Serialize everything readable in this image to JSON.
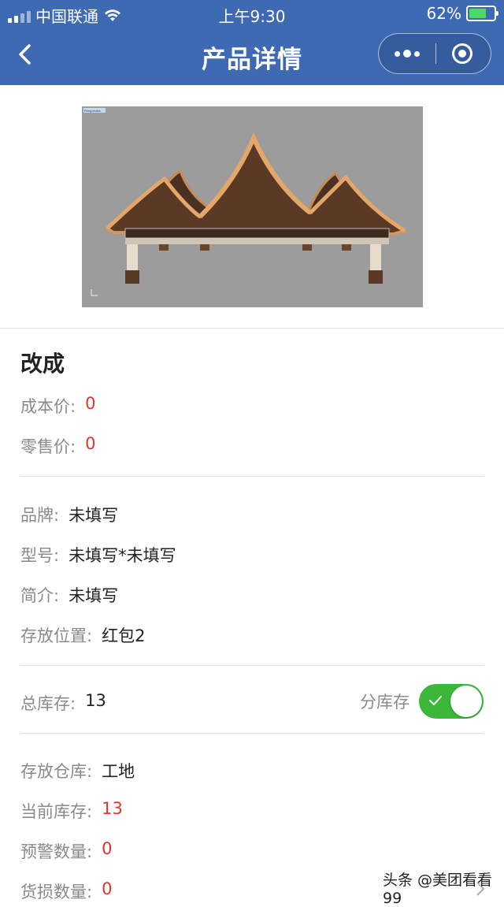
{
  "status_bar": {
    "carrier": "中国联通",
    "time": "上午9:30",
    "battery": "62%",
    "battery_level": 0.62
  },
  "nav": {
    "title": "产品详情",
    "back_icon": "chevron-left-icon",
    "more_icon": "more-dots-icon",
    "close_icon": "target-circle-icon"
  },
  "product": {
    "image_label": "Perspective",
    "name": "改成",
    "cost_label": "成本价:",
    "cost_value": "0",
    "retail_label": "零售价:",
    "retail_value": "0"
  },
  "details": {
    "brand_label": "品牌:",
    "brand_value": "未填写",
    "model_label": "型号:",
    "model_value": "未填写*未填写",
    "intro_label": "简介:",
    "intro_value": "未填写",
    "location_label": "存放位置:",
    "location_value": "红包2"
  },
  "stock": {
    "total_label": "总库存:",
    "total_value": "13",
    "sub_label": "分库存",
    "sub_enabled": true
  },
  "warehouse": {
    "warehouse_label": "存放仓库:",
    "warehouse_value": "工地",
    "current_label": "当前库存:",
    "current_value": "13",
    "warning_label": "预警数量:",
    "warning_value": "0",
    "damage_label": "货损数量:",
    "damage_value": "0"
  },
  "watermark": "头条 @美团看看99",
  "colors": {
    "nav_bg": "#3d6ab3",
    "accent_red": "#e0342f",
    "toggle_green": "#3cb73a"
  }
}
